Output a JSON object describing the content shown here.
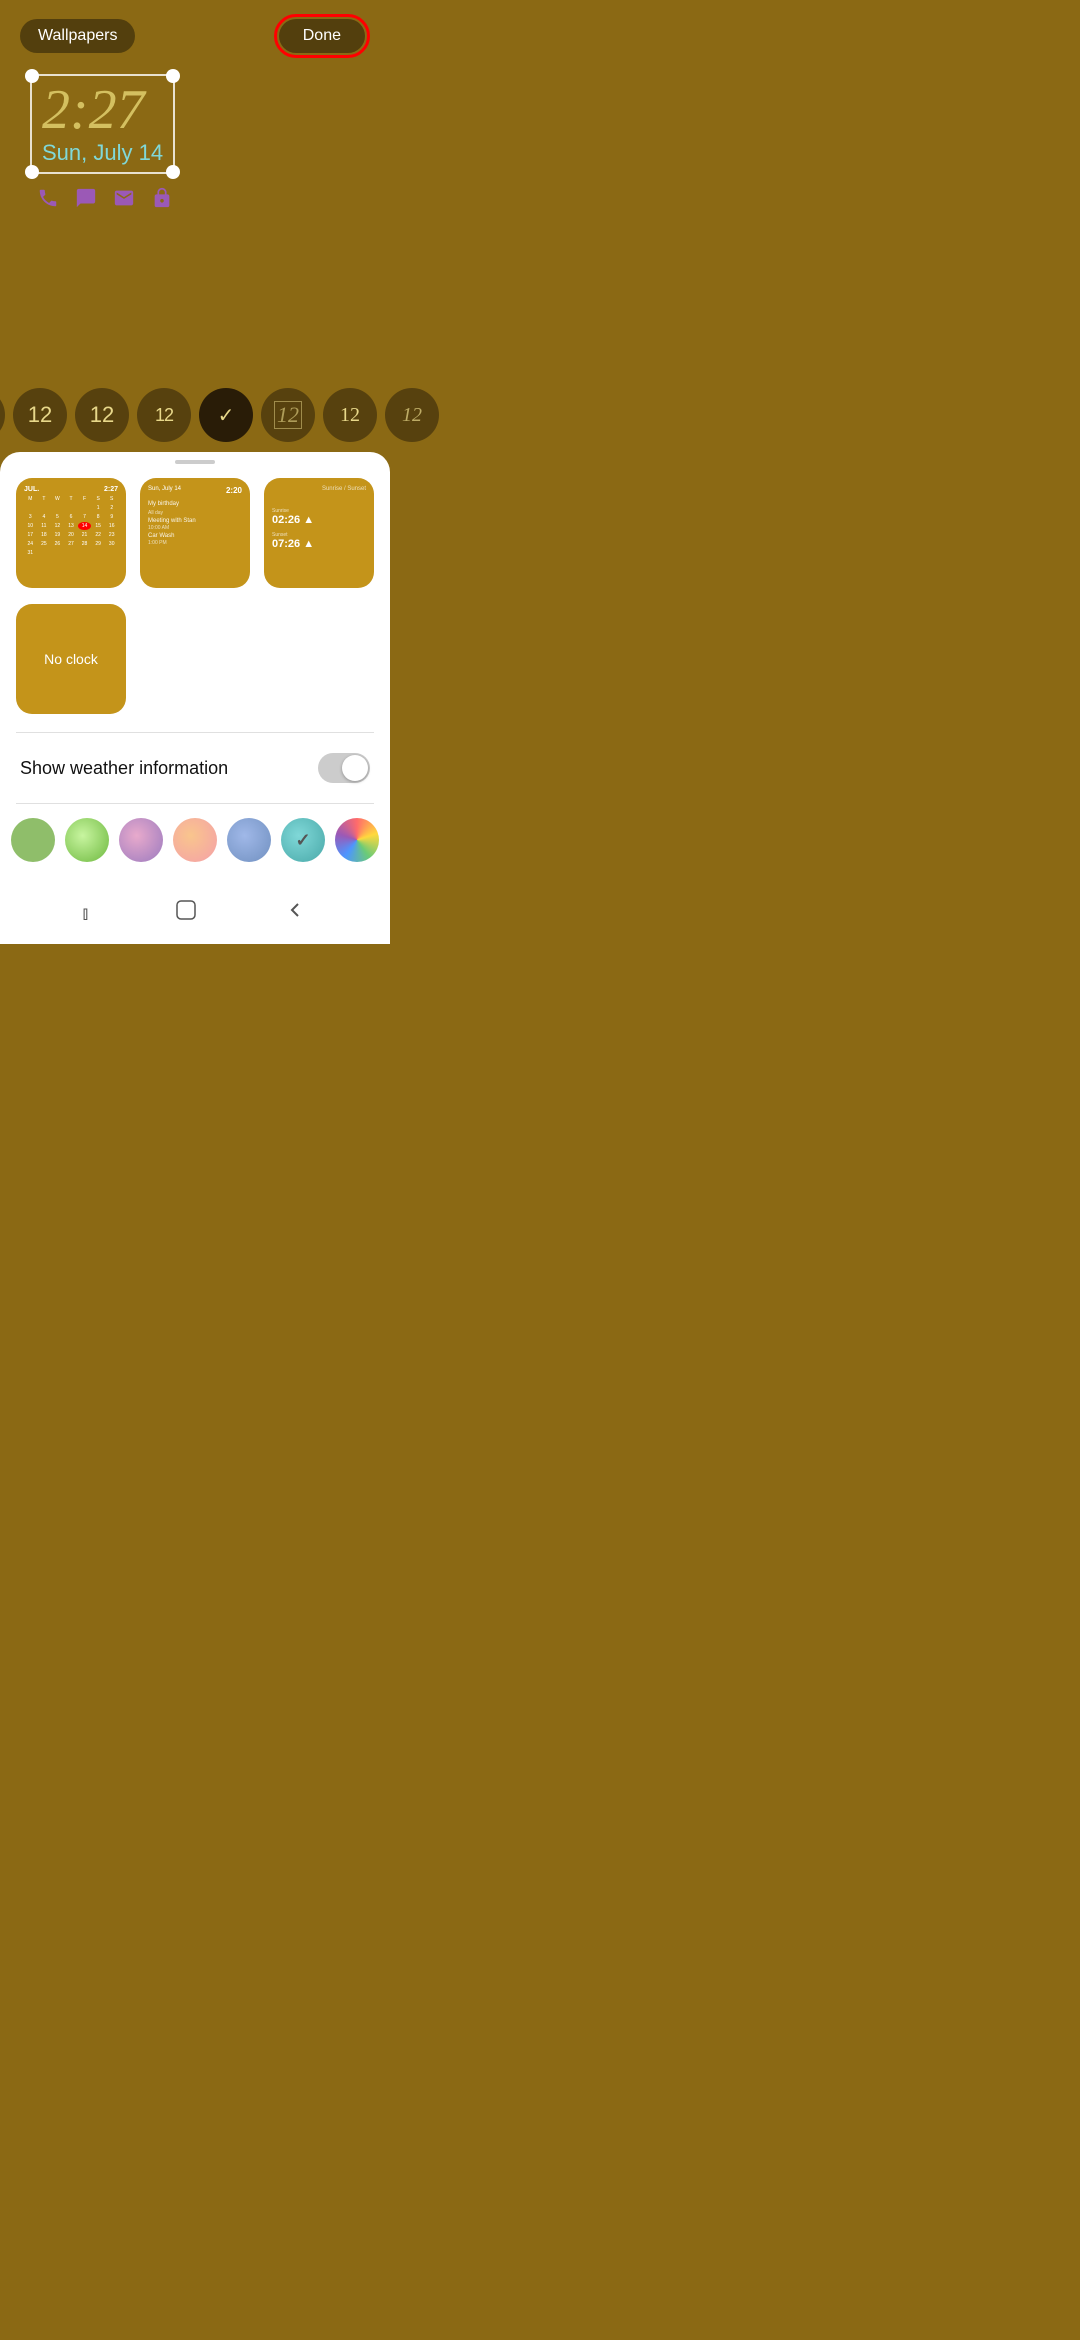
{
  "topBar": {
    "wallpapersLabel": "Wallpapers",
    "doneLabel": "Done"
  },
  "clockWidget": {
    "time": "2:27",
    "date": "Sun, July 14"
  },
  "clockStyles": [
    {
      "id": "style1",
      "display": "12",
      "type": "bold-rounded"
    },
    {
      "id": "style2",
      "display": "12",
      "type": "medium"
    },
    {
      "id": "style3",
      "display": "12",
      "type": "light"
    },
    {
      "id": "style4",
      "display": "12",
      "type": "condensed"
    },
    {
      "id": "style5",
      "display": "↓",
      "type": "dropdown",
      "active": true
    },
    {
      "id": "style6",
      "display": "12",
      "type": "outline-italic"
    },
    {
      "id": "style7",
      "display": "12",
      "type": "serif"
    },
    {
      "id": "style8",
      "display": "12",
      "type": "serif-italic"
    }
  ],
  "thumbnails": [
    {
      "id": "thumb-calendar",
      "type": "calendar"
    },
    {
      "id": "thumb-schedule",
      "type": "schedule"
    },
    {
      "id": "thumb-alarm",
      "type": "alarm"
    }
  ],
  "noClockLabel": "No clock",
  "weatherToggle": {
    "label": "Show weather information",
    "enabled": false
  },
  "colorSwatches": [
    {
      "id": "green-solid",
      "color": "#8fbe6a"
    },
    {
      "id": "green-gradient",
      "colors": [
        "#a8e063",
        "#56ab2f"
      ]
    },
    {
      "id": "pink-gradient",
      "colors": [
        "#f7797d",
        "#b7a7d3"
      ]
    },
    {
      "id": "peach-gradient",
      "colors": [
        "#f9c58d",
        "#f492a0"
      ]
    },
    {
      "id": "blue-purple-gradient",
      "colors": [
        "#6a85b6",
        "#bac8e0"
      ]
    },
    {
      "id": "teal-selected",
      "color": "#5fc3c0",
      "selected": true
    },
    {
      "id": "multicolor",
      "colors": [
        "#ff6b6b",
        "#ffd93d",
        "#6bcb77",
        "#4d96ff"
      ]
    }
  ],
  "navBar": {
    "recentApps": "|||",
    "home": "□",
    "back": "<"
  },
  "calendar": {
    "month": "JUL.",
    "time": "2:27",
    "days": [
      "M",
      "T",
      "W",
      "T",
      "F",
      "S",
      "S"
    ],
    "dates": [
      [
        " ",
        " ",
        " ",
        " ",
        " ",
        "1",
        "2"
      ],
      [
        "3",
        "4",
        "5",
        "6",
        "7",
        "8",
        "9"
      ],
      [
        "10",
        "11",
        "12",
        "13",
        "14",
        "15",
        "16"
      ],
      [
        "17",
        "18",
        "19",
        "20",
        "21",
        "22",
        "23"
      ],
      [
        "24",
        "25",
        "26",
        "27",
        "28",
        "29",
        "30"
      ],
      [
        "31",
        " ",
        " ",
        " ",
        " ",
        " ",
        " "
      ]
    ],
    "today": "14"
  },
  "schedule": {
    "date": "Sun, July 14",
    "time": "2:20",
    "events": [
      {
        "name": "My birthday",
        "detail": "All day"
      },
      {
        "name": "Meeting with Stan",
        "time": "10:00 AM"
      },
      {
        "name": "Car Wash",
        "time": "1:00 PM"
      }
    ]
  },
  "alarm": {
    "top": "02:26 ▲",
    "bottom": "07:26 ▲"
  }
}
